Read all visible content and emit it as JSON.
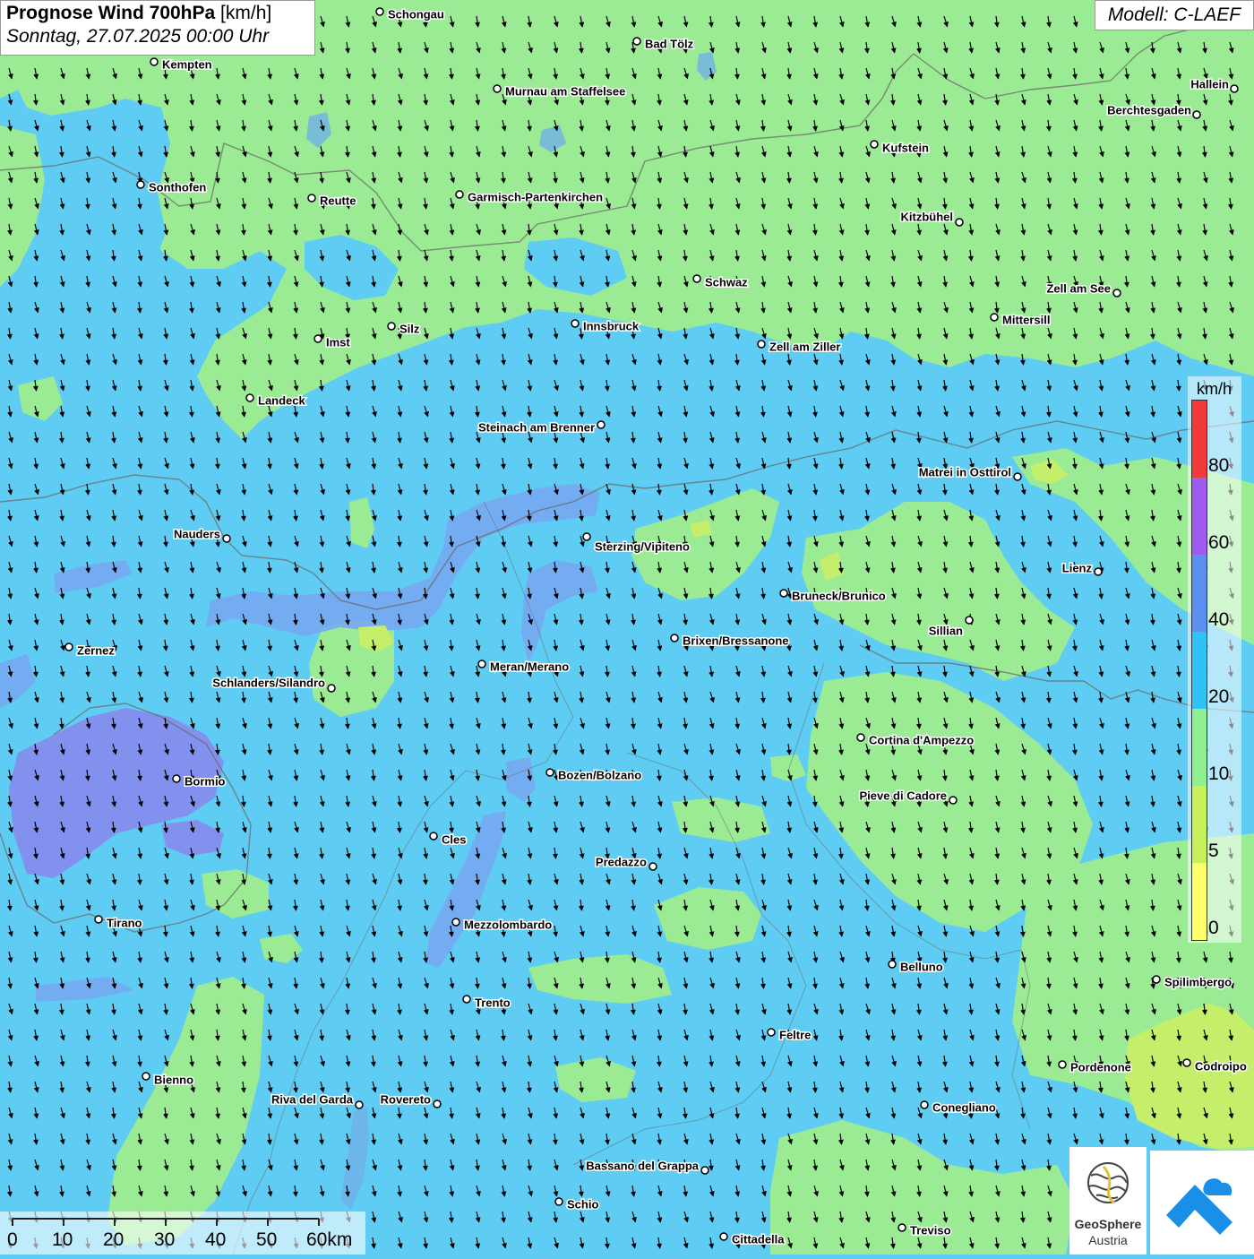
{
  "header": {
    "title_bold": "Prognose Wind 700hPa",
    "title_unit": "[km/h]",
    "datetime": "Sonntag, 27.07.2025 00:00 Uhr",
    "model": "Modell: C-LAEF"
  },
  "legend": {
    "unit": "km/h",
    "labels": [
      "80",
      "60",
      "40",
      "20",
      "10",
      "5",
      "0"
    ],
    "colors": {
      "over_80": "#f33a3a",
      "60_80": "#a05cf0",
      "40_60": "#5b8ff0",
      "20_40": "#2fc3f5",
      "10_20": "#8ff08f",
      "5_10": "#c7f05a",
      "0_5": "#ffff6a"
    }
  },
  "map": {
    "fill_colors": {
      "band_20_40": "#5fcdf3",
      "band_10_20": "#9beb94",
      "band_40_60": "#77a8f2",
      "band_60_80": "#8a86ec",
      "band_5_10": "#c5ee6a",
      "water": "#6fb0e8"
    },
    "wind_direction_icon": "arrow-south-southeast-icon",
    "cities": [
      {
        "name": "Schongau"
      },
      {
        "name": "Bad Tölz"
      },
      {
        "name": "Kempten"
      },
      {
        "name": "Murnau am Staffelsee"
      },
      {
        "name": "Hallein"
      },
      {
        "name": "Berchtesgaden"
      },
      {
        "name": "Kufstein"
      },
      {
        "name": "Sonthofen"
      },
      {
        "name": "Reutte"
      },
      {
        "name": "Garmisch-Partenkirchen"
      },
      {
        "name": "Kitzbühel"
      },
      {
        "name": "Schwaz"
      },
      {
        "name": "Zell am See"
      },
      {
        "name": "Mittersill"
      },
      {
        "name": "Innsbruck"
      },
      {
        "name": "Silz"
      },
      {
        "name": "Imst"
      },
      {
        "name": "Zell am Ziller"
      },
      {
        "name": "Landeck"
      },
      {
        "name": "Steinach am Brenner"
      },
      {
        "name": "Matrei in Osttirol"
      },
      {
        "name": "Nauders"
      },
      {
        "name": "Sterzing/Vipiteno"
      },
      {
        "name": "Lienz"
      },
      {
        "name": "Bruneck/Brunico"
      },
      {
        "name": "Sillian"
      },
      {
        "name": "Brixen/Bressanone"
      },
      {
        "name": "Zernez"
      },
      {
        "name": "Meran/Merano"
      },
      {
        "name": "Schlanders/Silandro"
      },
      {
        "name": "Cortina d'Ampezzo"
      },
      {
        "name": "Bozen/Bolzano"
      },
      {
        "name": "Bormio"
      },
      {
        "name": "Pieve di Cadore"
      },
      {
        "name": "Cles"
      },
      {
        "name": "Predazzo"
      },
      {
        "name": "Tirano"
      },
      {
        "name": "Mezzolombardo"
      },
      {
        "name": "Belluno"
      },
      {
        "name": "Spilimbergo"
      },
      {
        "name": "Trento"
      },
      {
        "name": "Feltre"
      },
      {
        "name": "Pordenone"
      },
      {
        "name": "Codroipo"
      },
      {
        "name": "Bienno"
      },
      {
        "name": "Riva del Garda"
      },
      {
        "name": "Rovereto"
      },
      {
        "name": "Conegliano"
      },
      {
        "name": "Bassano del Grappa"
      },
      {
        "name": "Schio"
      },
      {
        "name": "Treviso"
      },
      {
        "name": "Cittadella"
      }
    ]
  },
  "scale_bar": {
    "labels": [
      "0",
      "10",
      "20",
      "30",
      "40",
      "50",
      "60km"
    ]
  },
  "logos": {
    "geosphere_name": "GeoSphere",
    "geosphere_sub": "Austria"
  }
}
